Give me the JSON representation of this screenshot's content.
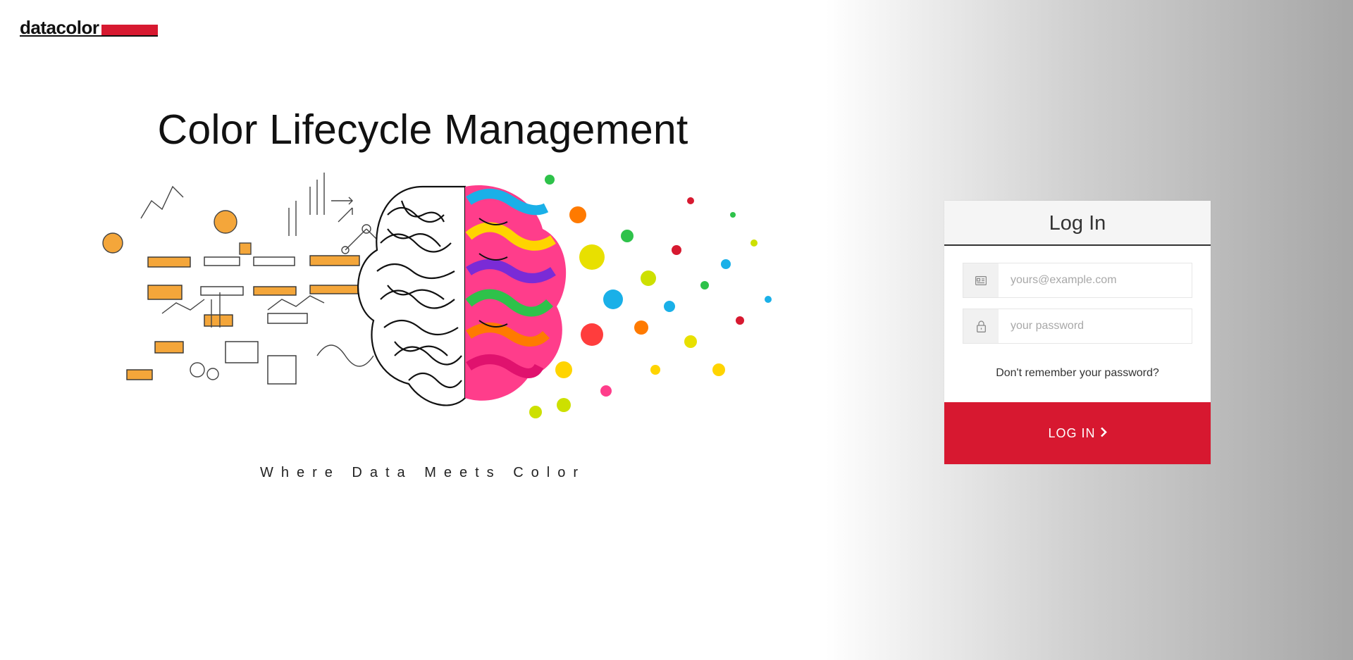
{
  "brand": {
    "logo_text": "datacolor",
    "accent_color": "#d71930"
  },
  "hero": {
    "title": "Color Lifecycle Management",
    "tagline": "Where Data Meets Color",
    "art": "brain illustration: sketch doodles left, colorful paint splash right"
  },
  "login": {
    "heading": "Log In",
    "email": {
      "icon": "id-card-icon",
      "value": "",
      "placeholder": "yours@example.com"
    },
    "password": {
      "icon": "lock-icon",
      "value": "",
      "placeholder": "your password"
    },
    "forgot_label": "Don't remember your password?",
    "submit_label": "LOG IN",
    "submit_icon": "chevron-right-icon",
    "button_color": "#d71830"
  }
}
